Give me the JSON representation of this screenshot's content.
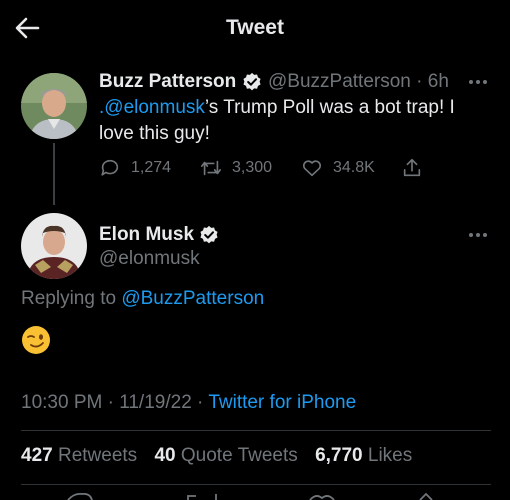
{
  "header": {
    "title": "Tweet",
    "back_icon": "arrow-left-icon"
  },
  "parent_tweet": {
    "name": "Buzz Patterson",
    "handle": "@BuzzPatterson",
    "time": "· 6h",
    "mention": ".@elonmusk",
    "text_rest": "’s Trump Poll was a bot trap! I love this guy!",
    "replies": "1,274",
    "retweets": "3,300",
    "likes": "34.8K"
  },
  "main_tweet": {
    "name": "Elon Musk",
    "handle": "@elonmusk",
    "replying_label": "Replying to ",
    "replying_to": "@BuzzPatterson",
    "emoji": "😉",
    "timestamp": "10:30 PM · 11/19/22 · ",
    "source": "Twitter for iPhone"
  },
  "stats": {
    "retweets_count": "427",
    "retweets_label": "Retweets",
    "quotes_count": "40",
    "quotes_label": "Quote Tweets",
    "likes_count": "6,770",
    "likes_label": "Likes"
  },
  "colors": {
    "accent": "#1d9bf0",
    "muted": "#71767b",
    "text": "#e7e9ea",
    "background": "#000000"
  }
}
